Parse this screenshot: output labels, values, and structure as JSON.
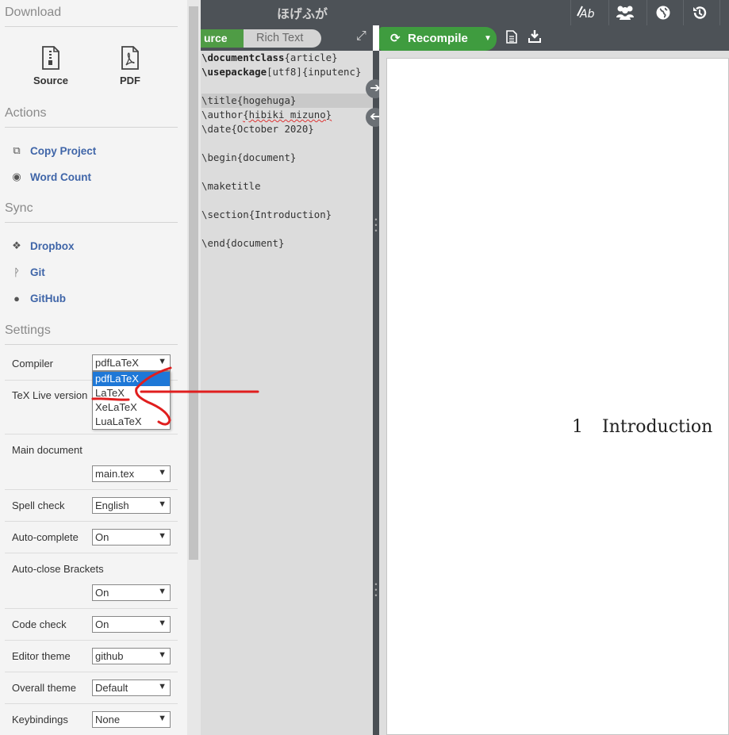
{
  "menu": {
    "download": {
      "heading": "Download",
      "source_label": "Source",
      "pdf_label": "PDF"
    },
    "actions": {
      "heading": "Actions",
      "items": [
        {
          "label": "Copy Project",
          "icon": "copy-icon"
        },
        {
          "label": "Word Count",
          "icon": "eye-icon"
        }
      ]
    },
    "sync": {
      "heading": "Sync",
      "items": [
        {
          "label": "Dropbox",
          "icon": "dropbox-icon"
        },
        {
          "label": "Git",
          "icon": "git-icon"
        },
        {
          "label": "GitHub",
          "icon": "github-icon"
        }
      ]
    },
    "settings": {
      "heading": "Settings",
      "compiler": {
        "label": "Compiler",
        "value": "pdfLaTeX"
      },
      "texlive": {
        "label": "TeX Live version"
      },
      "main_document": {
        "label": "Main document",
        "value": "main.tex"
      },
      "spell_check": {
        "label": "Spell check",
        "value": "English"
      },
      "auto_complete": {
        "label": "Auto-complete",
        "value": "On"
      },
      "auto_close": {
        "label": "Auto-close Brackets",
        "value": "On"
      },
      "code_check": {
        "label": "Code check",
        "value": "On"
      },
      "editor_theme": {
        "label": "Editor theme",
        "value": "github"
      },
      "overall_theme": {
        "label": "Overall theme",
        "value": "Default"
      },
      "keybindings": {
        "label": "Keybindings",
        "value": "None"
      }
    },
    "compiler_options": [
      "pdfLaTeX",
      "LaTeX",
      "XeLaTeX",
      "LuaLaTeX"
    ],
    "compiler_selected_index": 0
  },
  "topbar": {
    "project_title": "ほげふが",
    "icons": [
      "review-icon",
      "share-icon",
      "history-globe-icon",
      "history-icon",
      "chat-icon"
    ]
  },
  "editor_toolbar": {
    "source_label": "urce",
    "rich_text_label": "Rich Text"
  },
  "pdf_toolbar": {
    "recompile_label": "Recompile"
  },
  "editor": {
    "lines": [
      {
        "cmd": "\\documentclass",
        "arg": "{article}"
      },
      {
        "cmd": "\\usepackage",
        "arg": "[utf8]{inputenc}"
      },
      {
        "cmd": "",
        "arg": ""
      },
      {
        "cmd": "\\title",
        "arg": "{hogehuga}"
      },
      {
        "cmd": "\\author",
        "arg": "{hibiki mizuno}"
      },
      {
        "cmd": "\\date",
        "arg": "{October 2020}"
      },
      {
        "cmd": "",
        "arg": ""
      },
      {
        "cmd": "\\begin",
        "arg": "{document}"
      },
      {
        "cmd": "",
        "arg": ""
      },
      {
        "cmd": "\\maketitle",
        "arg": ""
      },
      {
        "cmd": "",
        "arg": ""
      },
      {
        "cmd": "\\section",
        "arg": "{Introduction}"
      },
      {
        "cmd": "",
        "arg": ""
      },
      {
        "cmd": "\\end",
        "arg": "{document}"
      }
    ]
  },
  "pdf": {
    "section_number": "1",
    "section_title": "Introduction"
  },
  "colors": {
    "accent_green": "#3f9c3f",
    "link_blue": "#3f65a8",
    "selected_option": "#1e78d7",
    "annotation_red": "#e01e1e"
  }
}
